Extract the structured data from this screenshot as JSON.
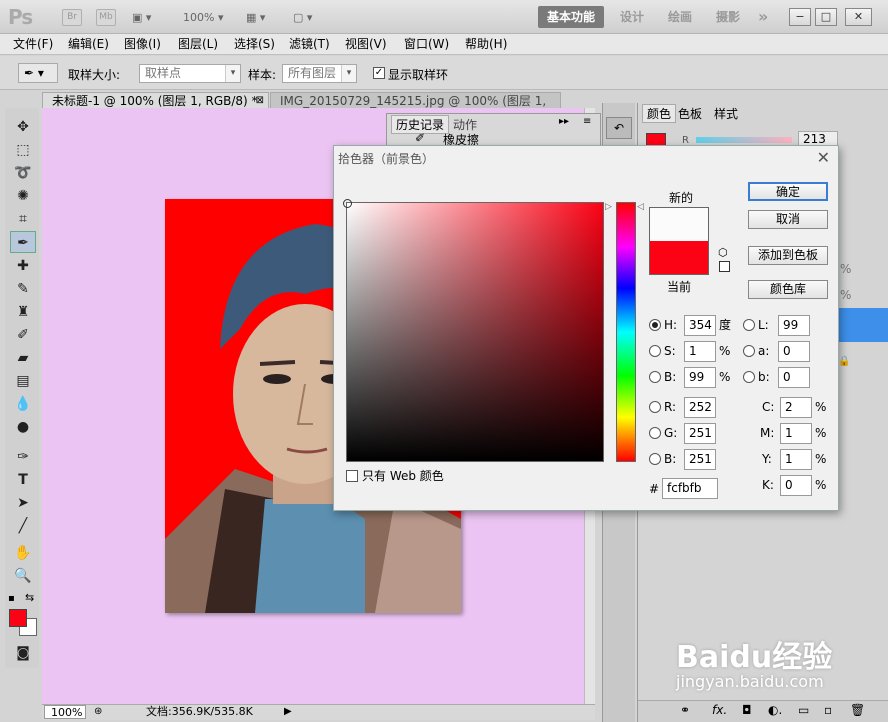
{
  "app": {
    "logo": "Ps",
    "chip_br": "Br",
    "chip_mb": "Mb",
    "zoom": "100%"
  },
  "workspace": {
    "active": "基本功能",
    "items": [
      "设计",
      "绘画",
      "摄影"
    ],
    "more": "»"
  },
  "window_controls": {
    "minimize": "−",
    "maximize": "□",
    "close": "✕"
  },
  "menu": [
    "文件(F)",
    "编辑(E)",
    "图像(I)",
    "图层(L)",
    "选择(S)",
    "滤镜(T)",
    "视图(V)",
    "窗口(W)",
    "帮助(H)"
  ],
  "options": {
    "sample_size_label": "取样大小:",
    "sample_size_value": "取样点",
    "sample_label": "样本:",
    "sample_value": "所有图层",
    "show_ring_label": "显示取样环",
    "show_ring_checked": true
  },
  "tabs": [
    {
      "label": "未标题-1 @ 100% (图层 1, RGB/8) *",
      "active": true
    },
    {
      "label": "IMG_20150729_145215.jpg @ 100% (图层 1, ...",
      "active": false
    }
  ],
  "history_panel": {
    "tab1": "历史记录",
    "tab2": "动作",
    "item": "橡皮擦"
  },
  "color_panel": {
    "tabs": [
      "颜色",
      "色板",
      "样式"
    ],
    "r_label": "R",
    "r_value": "213"
  },
  "layers_panel": {
    "opacity_partial": "%",
    "fill_partial": "%"
  },
  "status": {
    "zoom": "100%",
    "doc": "文档:356.9K/535.8K"
  },
  "dialog": {
    "title": "拾色器（前景色）",
    "new_label": "新的",
    "current_label": "当前",
    "ok": "确定",
    "cancel": "取消",
    "add_swatch": "添加到色板",
    "libraries": "颜色库",
    "web_only": "只有 Web 颜色",
    "new_color": "#fcfbfb",
    "current_color": "#fc0215",
    "fields": {
      "H": "354",
      "H_unit": "度",
      "S": "1",
      "S_unit": "%",
      "B": "99",
      "B_unit": "%",
      "R": "252",
      "G": "251",
      "Bb": "251",
      "L": "99",
      "a": "0",
      "b": "0",
      "C": "2",
      "M": "1",
      "Y": "1",
      "K": "0",
      "pct": "%"
    },
    "hex_label": "#",
    "hex": "fcfbfb"
  },
  "watermark": {
    "text": "Baidu经验",
    "sub": "jingyan.baidu.com"
  },
  "colors": {
    "foreground": "#fc0215",
    "canvas_bg": "#ecc4f3",
    "photo_bg": "#ff0000"
  }
}
